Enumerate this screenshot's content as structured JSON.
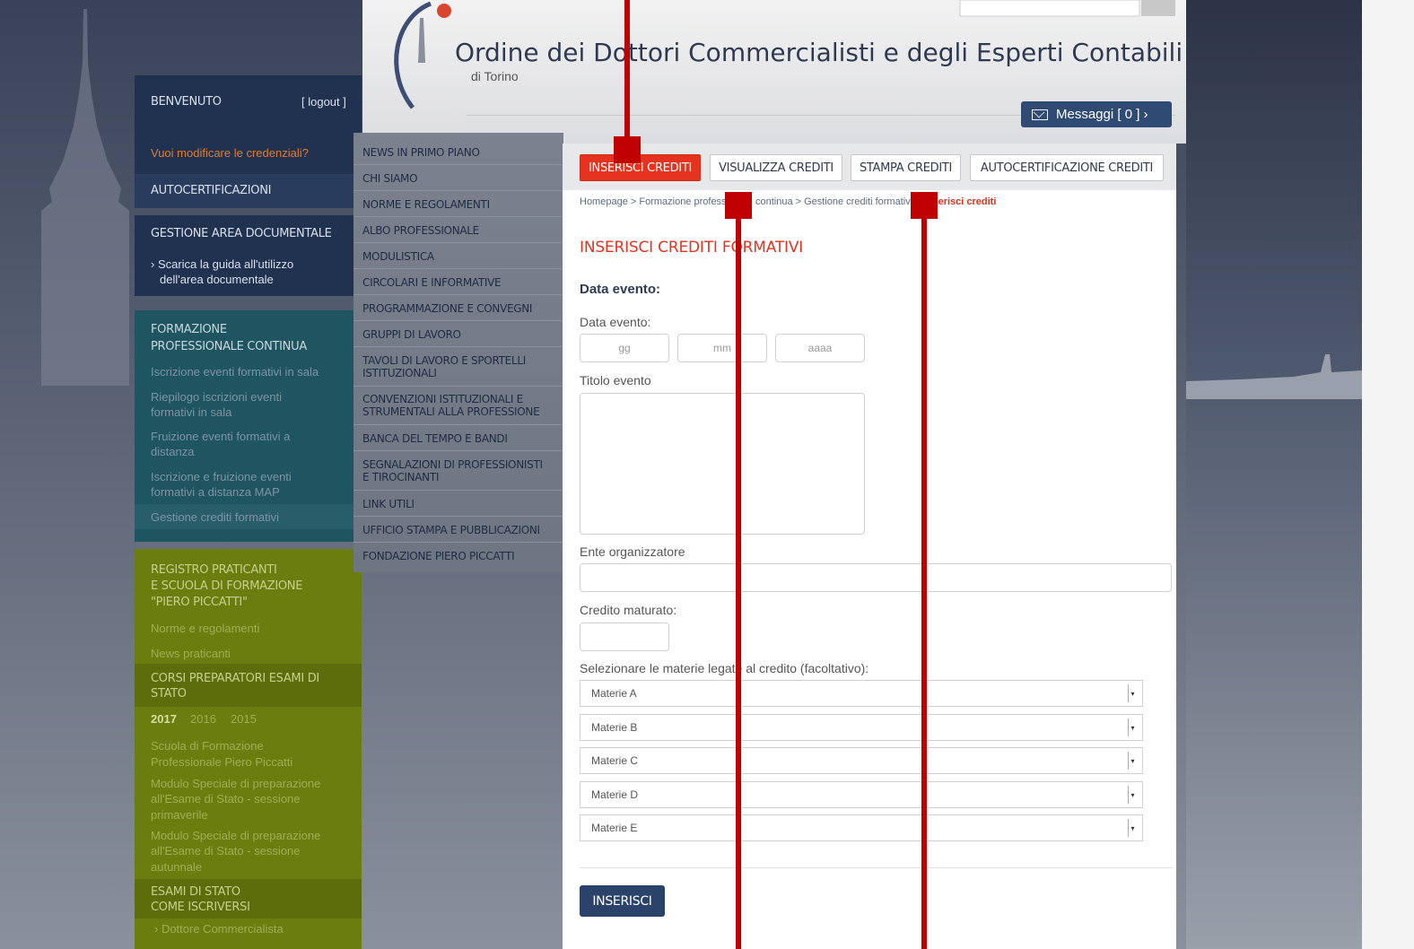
{
  "header": {
    "title": "Ordine dei Dottori Commercialisti e degli Esperti Contabili",
    "subtitle": "di Torino",
    "messages_label": "Messaggi [ 0 ] ›"
  },
  "sidebar": {
    "welcome": "BENVENUTO",
    "logout": "[ logout ]",
    "credentials": "Vuoi modificare le credenziali?",
    "autocert": "AUTOCERTIFICAZIONI",
    "doc_area": "GESTIONE AREA DOCUMENTALE",
    "doc_guide_1": "› Scarica la guida all'utilizzo",
    "doc_guide_2": "dell'area documentale",
    "fpc_title_1": "FORMAZIONE",
    "fpc_title_2": "PROFESSIONALE CONTINUA",
    "fpc_items": [
      "Iscrizione eventi formativi in sala",
      "Riepilogo iscrizioni eventi",
      "formativi in sala",
      "Fruizione eventi formativi a",
      "distanza",
      "Iscrizione e fruizione eventi",
      "formativi a distanza MAP",
      "Gestione crediti formativi"
    ],
    "reg_title_1": "REGISTRO PRATICANTI",
    "reg_title_2": "E SCUOLA DI FORMAZIONE",
    "reg_title_3": "\"PIERO PICCATTI\"",
    "reg_items": [
      "Norme e regolamenti",
      "News praticanti"
    ],
    "corsi_1": "CORSI PREPARATORI ESAMI DI",
    "corsi_2": "STATO",
    "years": [
      "2017",
      "2016",
      "2015"
    ],
    "scuola_items": [
      "Scuola di Formazione",
      "Professionale Piero Piccatti",
      "Modulo Speciale di preparazione",
      "all'Esame di Stato - sessione",
      "primaverile",
      "Modulo Speciale di preparazione",
      "all'Esame di Stato - sessione",
      "autunnale"
    ],
    "esami_1": "ESAMI DI STATO",
    "esami_2": "COME ISCRIVERSI",
    "dottore": "› Dottore Commercialista"
  },
  "menu": [
    "NEWS IN PRIMO PIANO",
    "CHI SIAMO",
    "NORME E REGOLAMENTI",
    "ALBO PROFESSIONALE",
    "MODULISTICA",
    "CIRCOLARI E INFORMATIVE",
    "PROGRAMMAZIONE E CONVEGNI",
    "GRUPPI DI LAVORO",
    "TAVOLI DI LAVORO E SPORTELLI",
    "ISTITUZIONALI",
    "CONVENZIONI ISTITUZIONALI E",
    "STRUMENTALI ALLA PROFESSIONE",
    "BANCA DEL TEMPO E BANDI",
    "SEGNALAZIONI DI PROFESSIONISTI",
    "E TIROCINANTI",
    "LINK UTILI",
    "UFFICIO STAMPA E PUBBLICAZIONI",
    "FONDAZIONE PIERO PICCATTI"
  ],
  "tabs": [
    "INSERISCI CREDITI",
    "VISUALIZZA CREDITI",
    "STAMPA CREDITI",
    "AUTOCERTIFICAZIONE CREDITI"
  ],
  "breadcrumb": {
    "path": "Homepage > Formazione professionale continua > Gestione crediti formativi > ",
    "current": "Inserisci crediti"
  },
  "form": {
    "title": "INSERISCI CREDITI FORMATIVI",
    "section": "Data evento:",
    "date_label": "Data evento:",
    "day_placeholder": "gg",
    "month_placeholder": "mm",
    "year_placeholder": "aaaa",
    "title_label": "Titolo evento",
    "ente_label": "Ente organizzatore",
    "credito_label": "Credito maturato:",
    "materie_label": "Selezionare le materie legate al credito (facoltativo):",
    "materie": [
      "Materie A",
      "Materie B",
      "Materie C",
      "Materie D",
      "Materie E"
    ],
    "submit": "INSERISCI"
  },
  "colors": {
    "accent_red": "#e5331f",
    "navy": "#2b426a",
    "marker": "#c00000"
  }
}
